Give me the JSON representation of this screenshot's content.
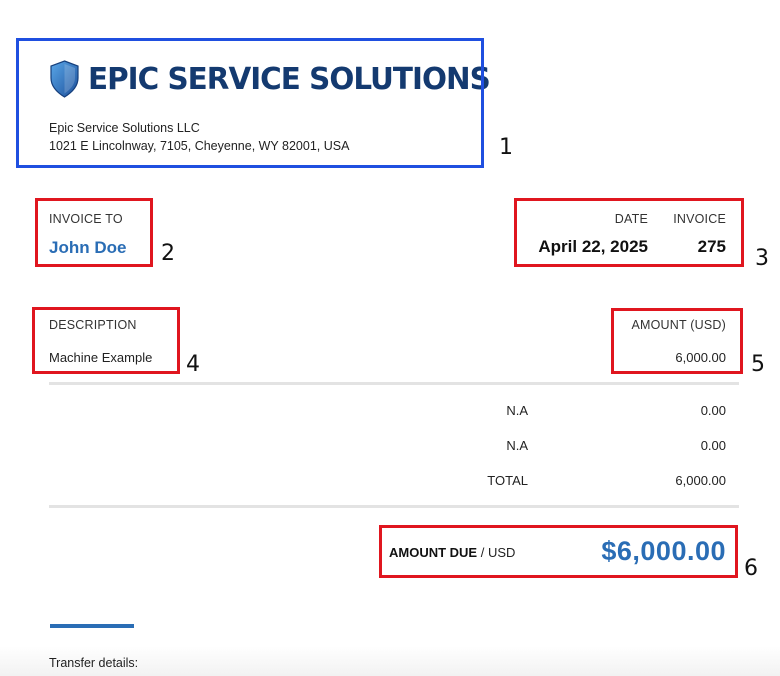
{
  "company": {
    "name": "EPIC SERVICE SOLUTIONS",
    "legal_name": "Epic Service Solutions LLC",
    "address": "1021 E Lincolnway, 7105, Cheyenne, WY 82001, USA",
    "brand_color": "#143a70",
    "logo_icon": "shield-icon"
  },
  "invoice_to": {
    "label": "INVOICE TO",
    "name": "John Doe"
  },
  "meta": {
    "date_label": "DATE",
    "invoice_label": "INVOICE",
    "date": "April 22, 2025",
    "invoice_number": "275"
  },
  "items": {
    "description_label": "DESCRIPTION",
    "amount_label": "AMOUNT (USD)",
    "description": "Machine Example",
    "amount": "6,000.00"
  },
  "summary": [
    {
      "label": "N.A",
      "value": "0.00"
    },
    {
      "label": "N.A",
      "value": "0.00"
    },
    {
      "label": "TOTAL",
      "value": "6,000.00"
    }
  ],
  "amount_due": {
    "label": "AMOUNT DUE",
    "currency_sep": " / USD",
    "value": "$6,000.00",
    "accent_color": "#2a6db5"
  },
  "footer": {
    "transfer_label": "Transfer details:"
  },
  "annotations": [
    "1",
    "2",
    "3",
    "4",
    "5",
    "6"
  ],
  "colors": {
    "annotation_blue": "#1f4fe0",
    "annotation_red": "#e0161f"
  }
}
